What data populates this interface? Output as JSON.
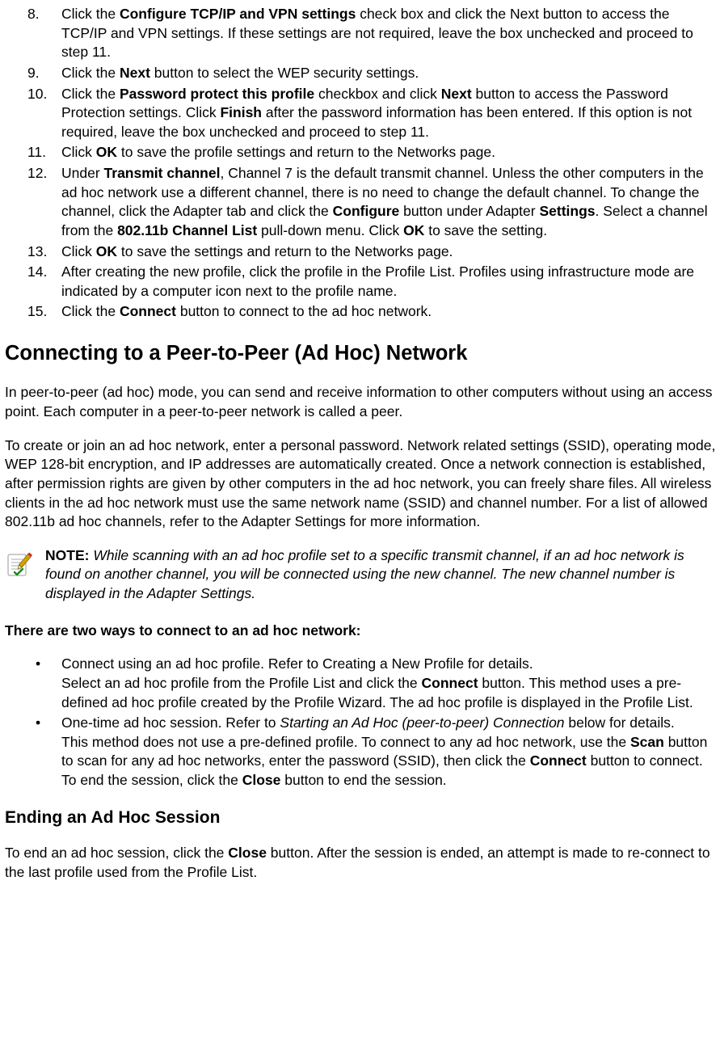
{
  "steps": {
    "s8_a": "Click the ",
    "s8_b": "Configure TCP/IP and VPN settings",
    "s8_c": " check box and click the Next button to access the TCP/IP and VPN settings. If these settings are not required, leave the box unchecked and proceed to step 11.",
    "s9_a": "Click the ",
    "s9_b": "Next",
    "s9_c": " button to select the WEP security settings.",
    "s10_a": "Click the ",
    "s10_b": "Password protect this profile",
    "s10_c": " checkbox and click ",
    "s10_d": "Next",
    "s10_e": " button to access the Password Protection settings. Click ",
    "s10_f": "Finish",
    "s10_g": " after the password information has been entered. If this option is not required, leave the box unchecked and proceed to step 11.",
    "s11_a": "Click ",
    "s11_b": "OK",
    "s11_c": " to save the profile settings and return to the Networks page.",
    "s12_a": "Under ",
    "s12_b": "Transmit channel",
    "s12_c": ", Channel 7 is the default transmit channel. Unless the other computers in the ad hoc network use a different channel, there is no need to change the default channel. To change the channel, click the Adapter tab and click the ",
    "s12_d": "Configure",
    "s12_e": " button under Adapter ",
    "s12_f": "Settings",
    "s12_g": ". Select a channel from the ",
    "s12_h": "802.11b Channel List",
    "s12_i": " pull-down menu. Click ",
    "s12_j": "OK",
    "s12_k": " to save the setting.",
    "s13_a": "Click ",
    "s13_b": "OK",
    "s13_c": " to save the settings and return to the Networks page.",
    "s14": "After creating the new profile, click the profile in the Profile List. Profiles using infrastructure mode are indicated by a computer icon next to the profile name.",
    "s15_a": "Click the ",
    "s15_b": "Connect",
    "s15_c": " button to connect to the ad hoc network."
  },
  "num": {
    "n8": "8.",
    "n9": "9.",
    "n10": "10.",
    "n11": "11.",
    "n12": "12.",
    "n13": "13.",
    "n14": "14.",
    "n15": "15."
  },
  "h_connecting": "Connecting to a Peer-to-Peer (Ad Hoc) Network",
  "p1": "In peer-to-peer (ad hoc) mode, you can send and receive information to other computers without using an access point. Each computer in a peer-to-peer network is called a peer.",
  "p2": "To create or join an ad hoc network, enter a personal password. Network related settings (SSID), operating mode, WEP 128-bit encryption, and IP addresses are automatically created. Once a network connection is established, after permission rights are given by other computers in the ad hoc network, you can freely share files. All wireless clients in the ad hoc network must use the same network name (SSID) and channel number. For a list of allowed 802.11b ad hoc channels, refer to the Adapter Settings for more information.",
  "note_label": "NOTE:",
  "note_body": " While scanning with an ad hoc profile set to a specific transmit channel, if an ad hoc network is found on another channel, you will be connected using the new channel. The new channel number is displayed in the Adapter Settings.",
  "twoways": "There are two ways to connect to an ad hoc network:",
  "bullets": {
    "b1_a": "Connect using an ad hoc profile. Refer to Creating a New Profile for details.",
    "b1_b_pre": "Select an ad hoc profile from the Profile List and click the ",
    "b1_b_bold": "Connect",
    "b1_b_post": " button. This method uses a pre-defined ad hoc profile created by the Profile Wizard. The ad hoc profile is displayed in the Profile List.",
    "b2_a_pre": "One-time ad hoc session. Refer to ",
    "b2_a_ital": "Starting an Ad Hoc (peer-to-peer) Connection",
    "b2_a_post": " below for details.",
    "b2_b_1": "This method does not use a pre-defined profile. To connect to any ad hoc network, use the ",
    "b2_b_scan": "Scan",
    "b2_b_2": " button to scan for any ad hoc networks, enter the password (SSID), then click the ",
    "b2_b_connect": "Connect",
    "b2_b_3": " button to connect. To end the session, click the ",
    "b2_b_close": "Close",
    "b2_b_4": " button to end the session."
  },
  "h_ending": "Ending an Ad Hoc Session",
  "p_end_a": "To end an ad hoc session, click the ",
  "p_end_b": "Close",
  "p_end_c": " button. After the session is ended, an attempt is made to re-connect to the last profile used from the Profile List."
}
